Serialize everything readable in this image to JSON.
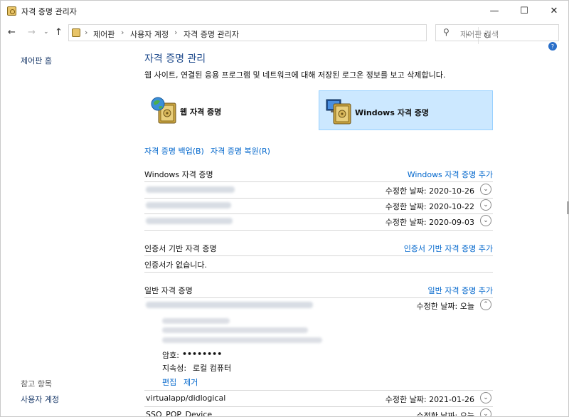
{
  "window": {
    "title": "자격 증명 관리자",
    "minimize": "—",
    "maximize": "☐",
    "close": "✕"
  },
  "nav": {
    "back": "←",
    "forward": "→",
    "recent": "⌄",
    "up": "↑",
    "breadcrumb": [
      "제어판",
      "사용자 계정",
      "자격 증명 관리자"
    ],
    "separator": "›",
    "refresh": "↻",
    "search_placeholder": "제어판 검색"
  },
  "left": {
    "home": "제어판 홈",
    "see_also": "참고 항목",
    "user_accounts": "사용자 계정"
  },
  "main": {
    "title": "자격 증명 관리",
    "description": "웹 사이트, 연결된 응용 프로그램 및 네트워크에 대해 저장된 로그온 정보를 보고 삭제합니다.",
    "web_credentials": "웹 자격 증명",
    "windows_credentials": "Windows 자격 증명",
    "backup": "자격 증명 백업(B)",
    "restore": "자격 증명 복원(R)",
    "sections": {
      "windows": {
        "header": "Windows 자격 증명",
        "add": "Windows 자격 증명 추가",
        "rows": [
          {
            "date": "수정한 날짜:  2020-10-26"
          },
          {
            "date": "수정한 날짜:  2020-10-22"
          },
          {
            "date": "수정한 날짜:  2020-09-03"
          }
        ]
      },
      "certificate": {
        "header": "인증서 기반 자격 증명",
        "add": "인증서 기반 자격 증명 추가",
        "empty": "인증서가 없습니다."
      },
      "generic": {
        "header": "일반 자격 증명",
        "add": "일반 자격 증명 추가",
        "expanded_date": "수정한 날짜:  오늘",
        "password_label": "암호:",
        "password_value": "••••••••",
        "persistence_label": "지속성:",
        "persistence_value": "로컬 컴퓨터",
        "edit": "편집",
        "remove": "제거",
        "rows": [
          {
            "name": "virtualapp/didlogical",
            "date": "수정한 날짜:  2021-01-26"
          },
          {
            "name": "SSO_POP_Device",
            "date": "수정한 날짜:  오늘"
          }
        ]
      }
    }
  },
  "icons": {
    "chevron_down": "⌄",
    "chevron_up": "⌃"
  }
}
